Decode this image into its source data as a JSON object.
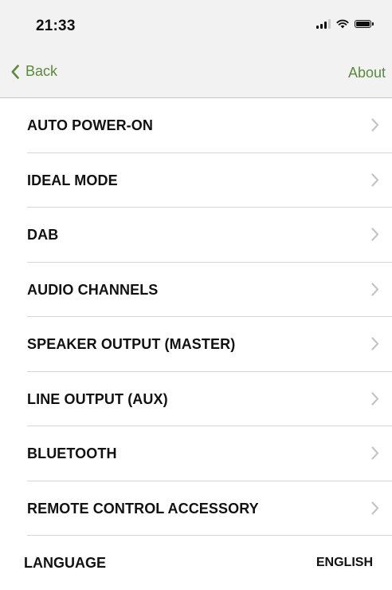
{
  "status_bar": {
    "time": "21:33",
    "icons": [
      "signal-icon",
      "wifi-icon",
      "battery-icon"
    ]
  },
  "nav": {
    "back_label": "Back",
    "about_label": "About",
    "accent_color": "#5a8a3c"
  },
  "menu": {
    "items": [
      {
        "label": "AUTO POWER-ON"
      },
      {
        "label": "IDEAL MODE"
      },
      {
        "label": "DAB"
      },
      {
        "label": "AUDIO CHANNELS"
      },
      {
        "label": "SPEAKER OUTPUT (MASTER)"
      },
      {
        "label": "LINE OUTPUT (AUX)"
      },
      {
        "label": "BLUETOOTH"
      },
      {
        "label": "REMOTE CONTROL ACCESSORY"
      }
    ]
  },
  "language": {
    "label": "LANGUAGE",
    "value": "ENGLISH"
  }
}
